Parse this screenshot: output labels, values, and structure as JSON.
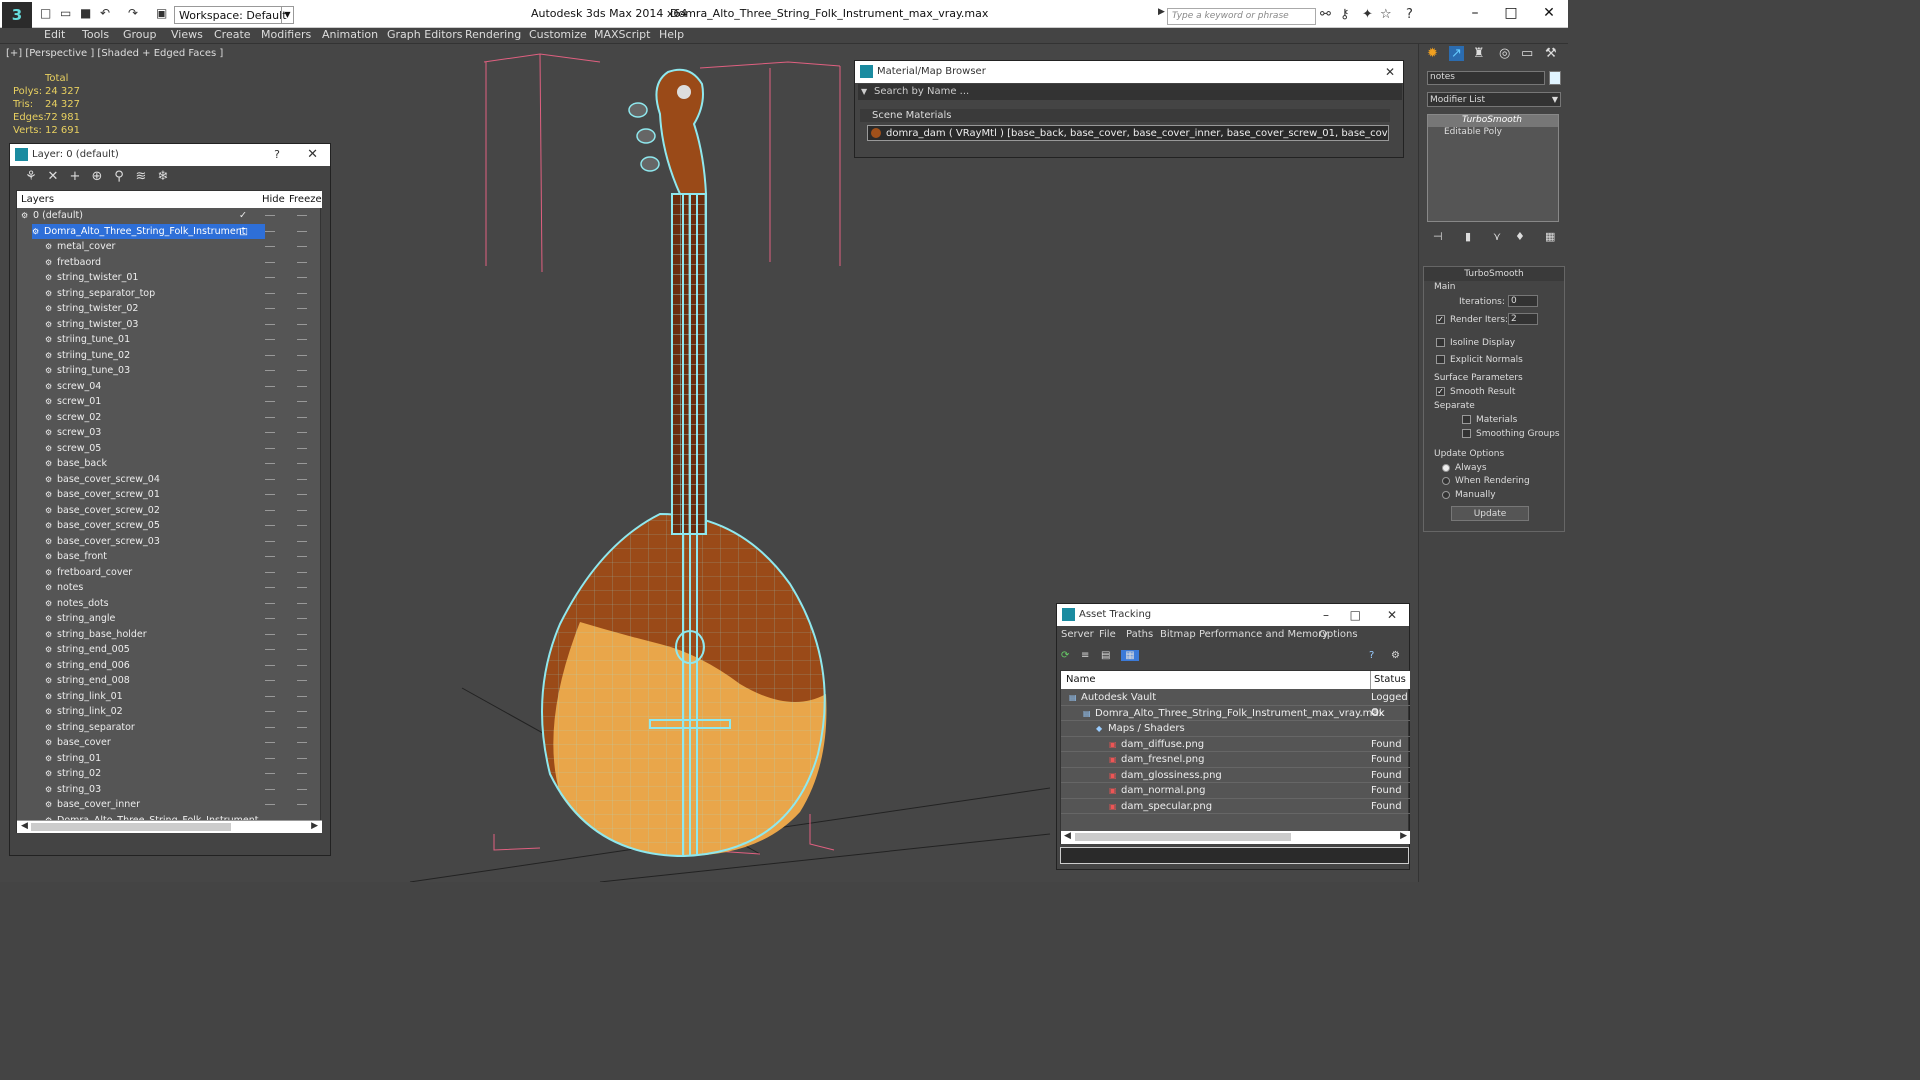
{
  "titlebar": {
    "workspace": "Workspace: Default",
    "title_app": "Autodesk 3ds Max  2014 x64",
    "title_file": "Domra_Alto_Three_String_Folk_Instrument_max_vray.max",
    "search_placeholder": "Type a keyword or phrase"
  },
  "menu": [
    "Edit",
    "Tools",
    "Group",
    "Views",
    "Create",
    "Modifiers",
    "Animation",
    "Graph Editors",
    "Rendering",
    "Customize",
    "MAXScript",
    "Help"
  ],
  "viewport": {
    "label": "[+] [Perspective ] [Shaded + Edged Faces ]",
    "stats_header": "Total",
    "stats": [
      {
        "label": "Polys:",
        "value": "24 327"
      },
      {
        "label": "Tris:",
        "value": "24 327"
      },
      {
        "label": "Edges:",
        "value": "72 981"
      },
      {
        "label": "Verts:",
        "value": "12 691"
      }
    ]
  },
  "layer_panel": {
    "title": "Layer: 0 (default)",
    "help": "?",
    "col_layers": "Layers",
    "col_hide": "Hide",
    "col_freeze": "Freeze",
    "default_layer": "0 (default)",
    "selected_layer": "Domra_Alto_Three_String_Folk_Instrument",
    "objects": [
      "metal_cover",
      "fretbaord",
      "string_twister_01",
      "string_separator_top",
      "string_twister_02",
      "string_twister_03",
      "striing_tune_01",
      "striing_tune_02",
      "striing_tune_03",
      "screw_04",
      "screw_01",
      "screw_02",
      "screw_03",
      "screw_05",
      "base_back",
      "base_cover_screw_04",
      "base_cover_screw_01",
      "base_cover_screw_02",
      "base_cover_screw_05",
      "base_cover_screw_03",
      "base_front",
      "fretboard_cover",
      "notes",
      "notes_dots",
      "string_angle",
      "string_base_holder",
      "string_end_005",
      "string_end_006",
      "string_end_008",
      "string_link_01",
      "string_link_02",
      "string_separator",
      "base_cover",
      "string_01",
      "string_02",
      "string_03",
      "base_cover_inner",
      "Domra_Alto_Three_String_Folk_Instrument"
    ]
  },
  "material_browser": {
    "title": "Material/Map Browser",
    "search": "Search by Name ...",
    "section": "Scene Materials",
    "item": "domra_dam  ( VRayMtl ) [base_back, base_cover, base_cover_inner, base_cover_screw_01, base_cover_screw_02, bas..."
  },
  "asset_tracking": {
    "title": "Asset Tracking",
    "menu": [
      "Server",
      "File",
      "Paths",
      "Bitmap Performance and Memory",
      "Options"
    ],
    "col_name": "Name",
    "col_status": "Status",
    "rows": [
      {
        "name": "Autodesk Vault",
        "status": "Logged O"
      },
      {
        "name": "Domra_Alto_Three_String_Folk_Instrument_max_vray.max",
        "status": "Ok"
      },
      {
        "name": "Maps / Shaders",
        "status": ""
      },
      {
        "name": "dam_diffuse.png",
        "status": "Found"
      },
      {
        "name": "dam_fresnel.png",
        "status": "Found"
      },
      {
        "name": "dam_glossiness.png",
        "status": "Found"
      },
      {
        "name": "dam_normal.png",
        "status": "Found"
      },
      {
        "name": "dam_specular.png",
        "status": "Found"
      }
    ]
  },
  "command_panel": {
    "name_field": "notes",
    "modifier_list": "Modifier List",
    "stack": [
      "TurboSmooth",
      "Editable Poly"
    ],
    "rollout": "TurboSmooth",
    "main": "Main",
    "iterations_label": "Iterations:",
    "iterations": "0",
    "render_iters_label": "Render Iters:",
    "render_iters": "2",
    "isoline": "Isoline Display",
    "explicit": "Explicit Normals",
    "surface": "Surface Parameters",
    "smooth_result": "Smooth Result",
    "separate": "Separate",
    "materials": "Materials",
    "smoothing_groups": "Smoothing Groups",
    "update_options": "Update Options",
    "always": "Always",
    "when_rendering": "When Rendering",
    "manually": "Manually",
    "update_btn": "Update"
  },
  "colors": {
    "accent": "#2e6fd8",
    "wire": "#8fe8ee",
    "wood_front": "#e9a64a",
    "wood_back": "#9a4a18",
    "stats": "#e8d060"
  }
}
